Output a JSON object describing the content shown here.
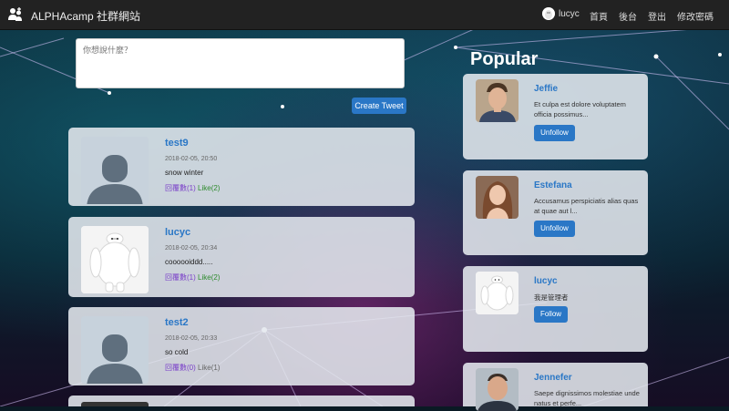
{
  "navbar": {
    "brand": "ALPHAcamp 社群網站",
    "username": "lucyc",
    "links": [
      "首頁",
      "後台",
      "登出",
      "修改密碼"
    ]
  },
  "composer": {
    "placeholder": "你想說什麼？",
    "submit_label": "Create Tweet"
  },
  "tweets": [
    {
      "user": "test9",
      "time": "2018-02-05, 20:50",
      "text": "snow winter",
      "reply": "回覆數(1)",
      "like": "Like(2)"
    },
    {
      "user": "lucyc",
      "time": "2018-02-05, 20:34",
      "text": "coooooiddd.....",
      "reply": "回覆數(1)",
      "like": "Like(2)"
    },
    {
      "user": "test2",
      "time": "2018-02-05, 20:33",
      "text": "so cold",
      "reply": "回覆數(0)",
      "like": "Like(1)"
    }
  ],
  "popular": {
    "title": "Popular",
    "users": [
      {
        "name": "Jeffie",
        "desc": "Et culpa est dolore voluptatem officia possimus...",
        "button": "Unfollow"
      },
      {
        "name": "Estefana",
        "desc": "Accusamus perspiciatis alias quas at quae aut l...",
        "button": "Unfollow"
      },
      {
        "name": "lucyc",
        "desc": "我是管理者",
        "button": "Follow"
      },
      {
        "name": "Jennefer",
        "desc": "Saepe dignissimos molestiae unde natus et perfe...",
        "button": ""
      }
    ]
  },
  "colors": {
    "accent": "#2a77c6",
    "navbar": "#222222",
    "reply": "#7a3fc9",
    "like": "#2e8b2e"
  }
}
